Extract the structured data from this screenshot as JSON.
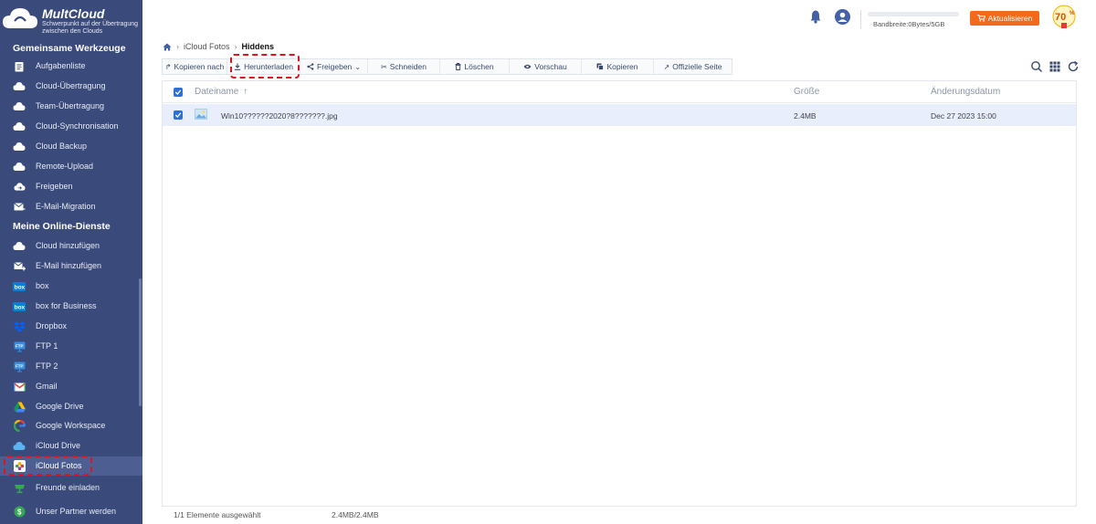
{
  "app": {
    "brand": "MultCloud",
    "tagline": "Schwerpunkt auf der Übertragung zwischen den Clouds"
  },
  "sidebar": {
    "section_tools": "Gemeinsame Werkzeuge",
    "tools": [
      {
        "label": "Aufgabenliste",
        "icon": "task-list-icon"
      },
      {
        "label": "Cloud-Übertragung",
        "icon": "cloud-transfer-icon"
      },
      {
        "label": "Team-Übertragung",
        "icon": "team-transfer-icon"
      },
      {
        "label": "Cloud-Synchronisation",
        "icon": "cloud-sync-icon"
      },
      {
        "label": "Cloud Backup",
        "icon": "cloud-backup-icon"
      },
      {
        "label": "Remote-Upload",
        "icon": "remote-upload-icon"
      },
      {
        "label": "Freigeben",
        "icon": "share-icon"
      },
      {
        "label": "E-Mail-Migration",
        "icon": "email-migration-icon"
      }
    ],
    "section_services": "Meine Online-Dienste",
    "services": [
      {
        "label": "Cloud hinzufügen",
        "icon": "add-cloud-icon"
      },
      {
        "label": "E-Mail hinzufügen",
        "icon": "add-email-icon"
      },
      {
        "label": "box",
        "icon": "box-icon"
      },
      {
        "label": "box for Business",
        "icon": "box-business-icon"
      },
      {
        "label": "Dropbox",
        "icon": "dropbox-icon"
      },
      {
        "label": "FTP 1",
        "icon": "ftp-icon"
      },
      {
        "label": "FTP 2",
        "icon": "ftp-icon"
      },
      {
        "label": "Gmail",
        "icon": "gmail-icon"
      },
      {
        "label": "Google Drive",
        "icon": "google-drive-icon"
      },
      {
        "label": "Google Workspace",
        "icon": "google-workspace-icon"
      },
      {
        "label": "iCloud Drive",
        "icon": "icloud-drive-icon"
      },
      {
        "label": "iCloud Fotos",
        "icon": "icloud-photos-icon"
      }
    ],
    "bottom": [
      {
        "label": "Freunde einladen",
        "icon": "invite-friends-icon"
      },
      {
        "label": "Unser Partner werden",
        "icon": "partner-icon"
      }
    ]
  },
  "header": {
    "bandwidth": "Bandbreite:0Bytes/5GB",
    "bandwidth_used_fraction": 0,
    "upgrade_label": "Aktualisieren",
    "promo_label": "70",
    "promo_unit": "%"
  },
  "breadcrumb": {
    "parent": "iCloud Fotos",
    "current": "Hiddens"
  },
  "toolbar": {
    "copy_to": "Kopieren nach",
    "download": "Herunterladen",
    "share": "Freigeben",
    "cut": "Schneiden",
    "delete": "Löschen",
    "preview": "Vorschau",
    "copy": "Kopieren",
    "official_page": "Offizielle Seite"
  },
  "table": {
    "col_name": "Dateiname",
    "col_size": "Größe",
    "col_date": "Änderungsdatum",
    "rows": [
      {
        "name": "Win10??????2020?8???????.jpg",
        "size": "2.4MB",
        "date": "Dec 27 2023 15:00",
        "selected": true
      }
    ]
  },
  "footer": {
    "selection": "1/1 Elemente ausgewählt",
    "size": "2.4MB/2.4MB"
  },
  "colors": {
    "sidebar_bg": "#3a4a7a",
    "accent": "#2f6fd6",
    "upgrade": "#f26a1b",
    "highlight": "#e0141e"
  }
}
